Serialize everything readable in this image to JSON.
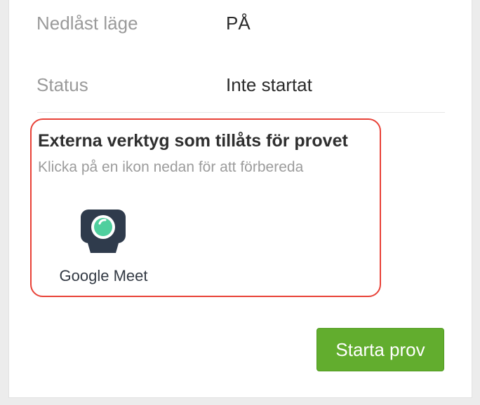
{
  "settings": {
    "rows": [
      {
        "label": "Nedlåst läge",
        "value": "PÅ"
      },
      {
        "label": "Status",
        "value": "Inte startat"
      }
    ]
  },
  "tools": {
    "title": "Externa verktyg som tillåts för provet",
    "subtitle": "Klicka på en ikon nedan för att förbereda",
    "items": [
      {
        "label": "Google Meet",
        "icon": "webcam-icon"
      }
    ]
  },
  "actions": {
    "start_label": "Starta prov"
  },
  "colors": {
    "highlight_border": "#e84137",
    "start_button": "#62ad2e",
    "icon_dark": "#2f3b4c",
    "icon_lens": "#4fcf9e"
  }
}
